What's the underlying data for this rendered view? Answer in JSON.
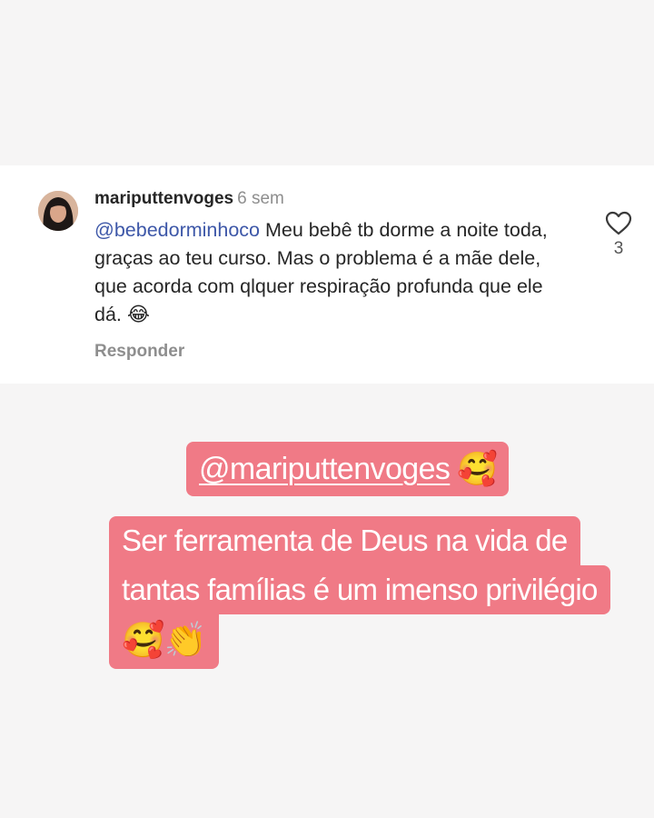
{
  "comment": {
    "username": "mariputtenvoges",
    "time": "6 sem",
    "mention": "@bebedorminhoco",
    "text": " Meu bebê tb dorme a noite toda, graças ao teu curso. Mas o problema é a mãe dele, que acorda com qlquer respiração profunda que ele dá. 😂",
    "reply_label": "Responder",
    "like_count": "3",
    "icons": {
      "avatar": "profile-photo",
      "like": "heart-outline-icon"
    }
  },
  "story": {
    "tag": "@mariputtenvoges",
    "tag_emoji": "🥰",
    "caption_lines": [
      "Ser ferramenta de Deus na vida de",
      "tantas famílias é um imenso privilégio",
      "🥰👏"
    ],
    "sticker_color": "#f07a86"
  }
}
